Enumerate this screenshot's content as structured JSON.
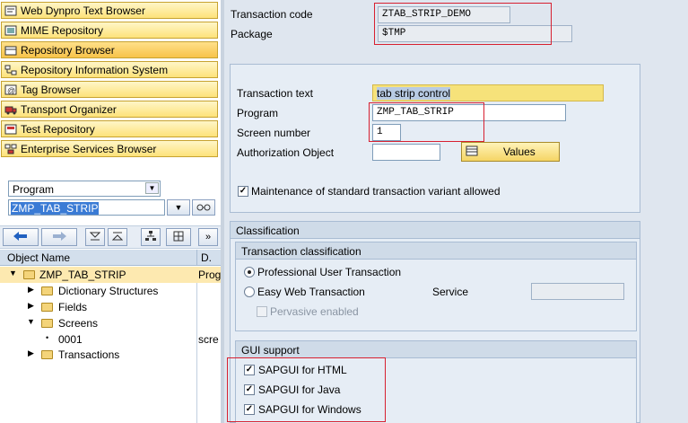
{
  "nav": {
    "items": [
      {
        "label": "Web Dynpro Text Browser",
        "icon": "text-browser-icon"
      },
      {
        "label": "MIME Repository",
        "icon": "mime-icon"
      },
      {
        "label": "Repository Browser",
        "icon": "repository-icon"
      },
      {
        "label": "Repository Information System",
        "icon": "info-system-icon"
      },
      {
        "label": "Tag Browser",
        "icon": "tag-icon"
      },
      {
        "label": "Transport Organizer",
        "icon": "truck-icon"
      },
      {
        "label": "Test Repository",
        "icon": "test-icon"
      },
      {
        "label": "Enterprise Services Browser",
        "icon": "services-icon"
      }
    ]
  },
  "object_type": {
    "value": "Program"
  },
  "object_name": {
    "value": "ZMP_TAB_STRIP"
  },
  "tree": {
    "col_name": "Object Name",
    "col_desc": "D.",
    "rows": [
      {
        "label": "ZMP_TAB_STRIP",
        "desc": "Prog"
      },
      {
        "label": "Dictionary Structures",
        "desc": ""
      },
      {
        "label": "Fields",
        "desc": ""
      },
      {
        "label": "Screens",
        "desc": ""
      },
      {
        "label": "0001",
        "desc": "scre"
      },
      {
        "label": "Transactions",
        "desc": ""
      }
    ]
  },
  "header": {
    "tcode_label": "Transaction code",
    "tcode_value": "ZTAB_STRIP_DEMO",
    "package_label": "Package",
    "package_value": "$TMP"
  },
  "form": {
    "text_label": "Transaction text",
    "text_value": "tab strip control",
    "program_label": "Program",
    "program_value": "ZMP_TAB_STRIP",
    "screen_label": "Screen number",
    "screen_value": "1",
    "auth_label": "Authorization Object",
    "auth_value": "",
    "values_button": "Values",
    "maint_label": "Maintenance of standard transaction variant allowed",
    "maint_checked": true
  },
  "classification": {
    "title": "Classification",
    "sub_title": "Transaction classification",
    "professional": "Professional User Transaction",
    "easy_web": "Easy Web Transaction",
    "service_label": "Service",
    "service_value": "",
    "pervasive": "Pervasive enabled"
  },
  "gui": {
    "title": "GUI support",
    "html": "SAPGUI for HTML",
    "java": "SAPGUI for Java",
    "windows": "SAPGUI for Windows"
  },
  "colors": {
    "nav_fill": "#fde27a",
    "highlight": "#f6e27a",
    "red_outline": "#d72030",
    "selection": "#3a7bd5"
  }
}
